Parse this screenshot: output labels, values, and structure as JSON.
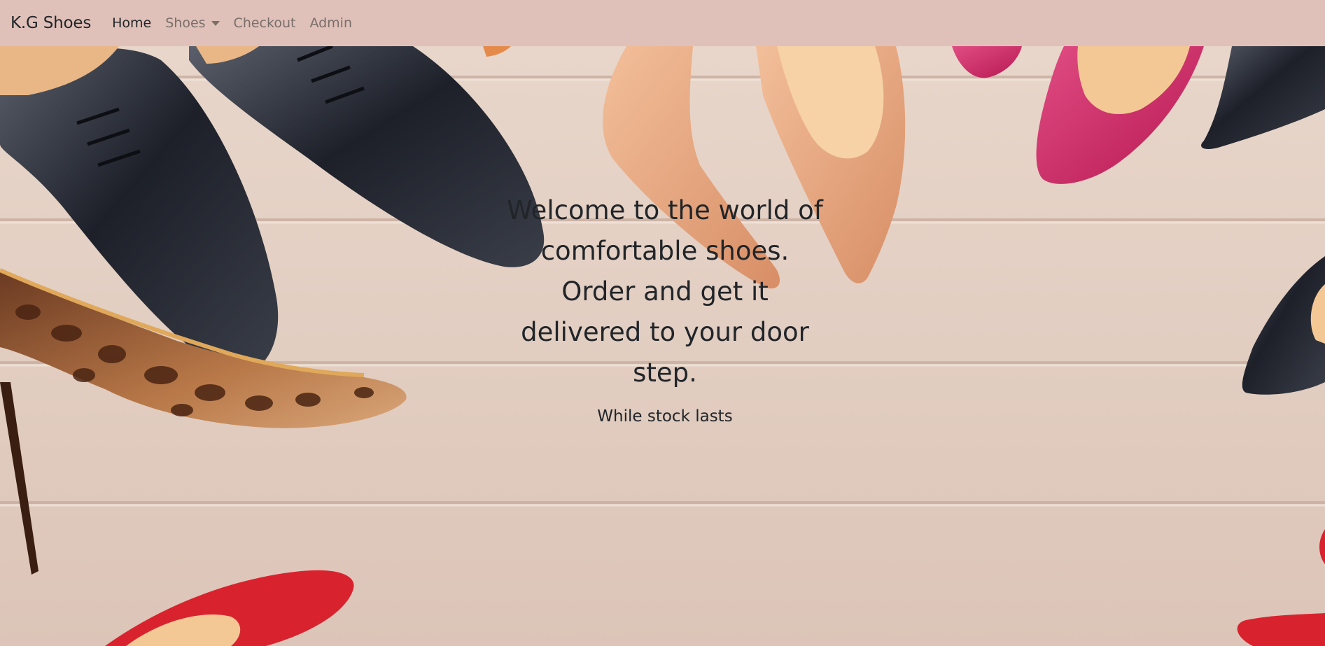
{
  "navbar": {
    "brand": "K.G Shoes",
    "links": [
      {
        "label": "Home",
        "active": true
      },
      {
        "label": "Shoes",
        "dropdown": true
      },
      {
        "label": "Checkout"
      },
      {
        "label": "Admin"
      }
    ],
    "background": "#dfc1b9"
  },
  "hero": {
    "headline": "Welcome to the world of comfortable shoes. Order and get it delivered to your door step.",
    "subtext": "While stock lasts"
  }
}
